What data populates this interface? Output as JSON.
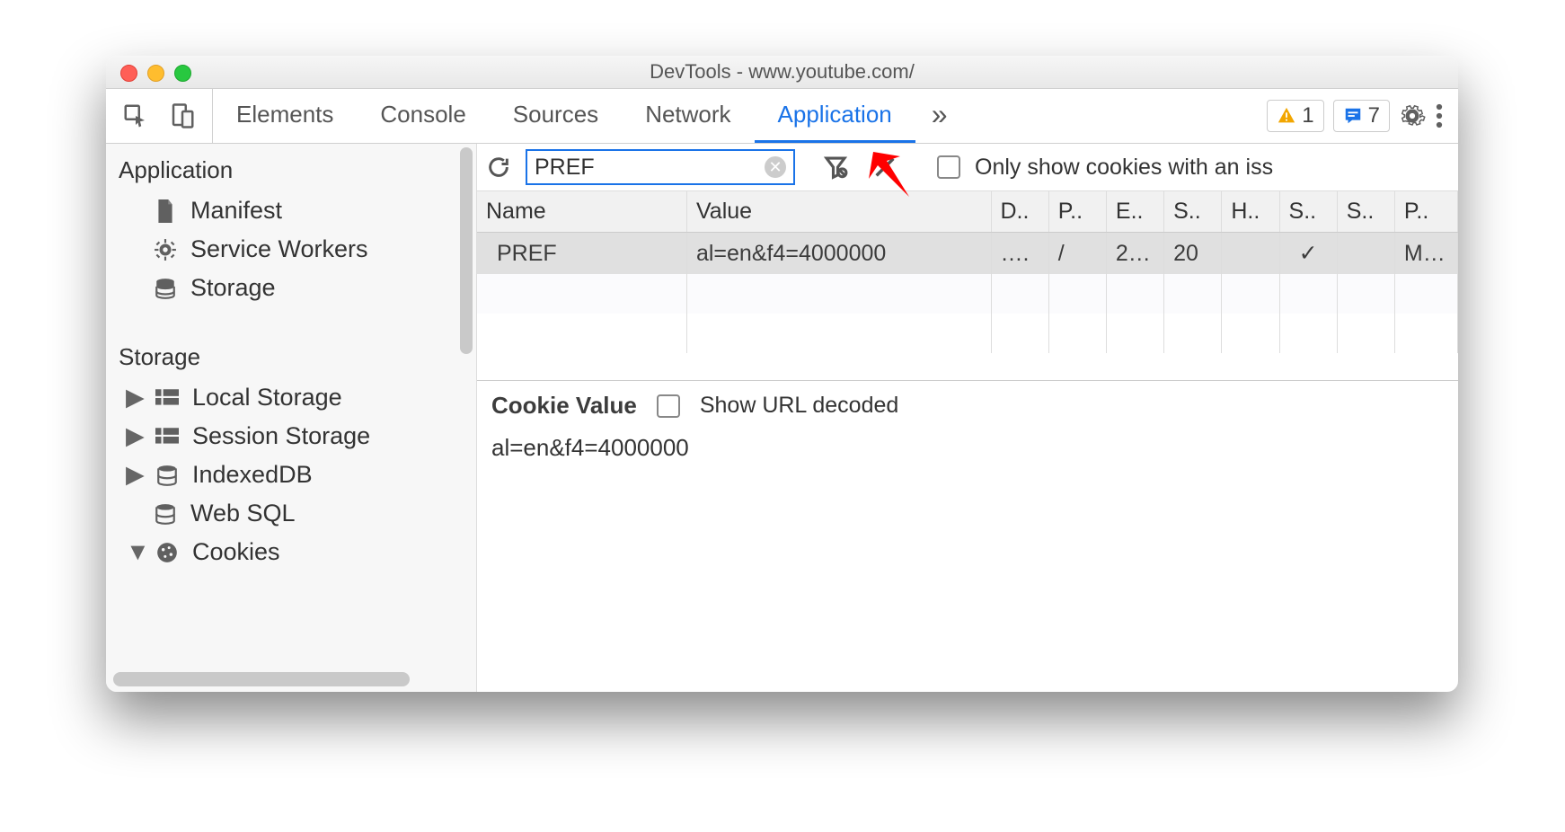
{
  "window": {
    "title": "DevTools - www.youtube.com/"
  },
  "toolbar": {
    "tabs": {
      "elements": "Elements",
      "console": "Console",
      "sources": "Sources",
      "network": "Network",
      "application": "Application",
      "more": "»"
    },
    "warn_count": "1",
    "msg_count": "7"
  },
  "sidebar": {
    "sections": {
      "application": "Application",
      "storage": "Storage"
    },
    "items": {
      "manifest": "Manifest",
      "service_workers": "Service Workers",
      "storage": "Storage",
      "local_storage": "Local Storage",
      "session_storage": "Session Storage",
      "indexeddb": "IndexedDB",
      "websql": "Web SQL",
      "cookies": "Cookies"
    }
  },
  "filter": {
    "value": "PREF",
    "only_show_label": "Only show cookies with an iss"
  },
  "table": {
    "headers": {
      "name": "Name",
      "value": "Value",
      "domain": "D..",
      "path": "P..",
      "expires": "E..",
      "size": "S..",
      "httponly": "H..",
      "secure": "S..",
      "samesite": "S..",
      "priority": "P.."
    },
    "rows": [
      {
        "name": "PREF",
        "value": "al=en&f4=4000000",
        "domain": "….",
        "path": "/",
        "expires": "2…",
        "size": "20",
        "httponly": "",
        "secure": "✓",
        "samesite": "",
        "priority": "M…"
      }
    ]
  },
  "detail": {
    "title": "Cookie Value",
    "show_decoded_label": "Show URL decoded",
    "value": "al=en&f4=4000000"
  }
}
